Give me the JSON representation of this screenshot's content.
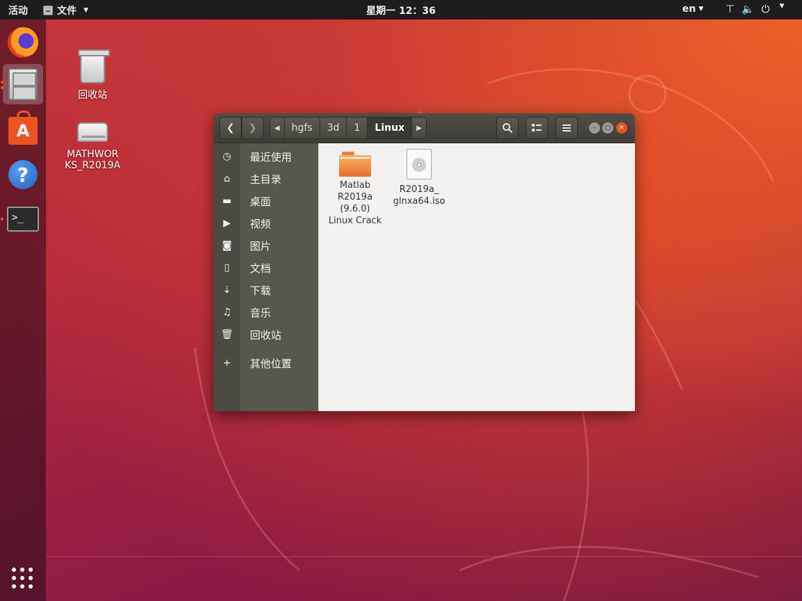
{
  "topbar": {
    "activities": "活动",
    "app_menu": "文件",
    "clock": "星期一 12：36",
    "lang": "en",
    "network_icon": "network-icon",
    "volume_icon": "volume-icon",
    "power_icon": "power-icon"
  },
  "dock": {
    "items": [
      "firefox",
      "files",
      "software-center",
      "help",
      "terminal"
    ],
    "show_apps_icon": "apps-grid-icon"
  },
  "desktop": {
    "icons": [
      {
        "label": "回收站",
        "icon": "trash-icon"
      },
      {
        "label": "MATHWORKS_R2019A",
        "icon": "drive-icon"
      }
    ]
  },
  "filemanager": {
    "path": [
      "hgfs",
      "3d",
      "1",
      "Linux"
    ],
    "sidebar": [
      {
        "label": "最近使用",
        "icon": "recent-icon"
      },
      {
        "label": "主目录",
        "icon": "home-icon"
      },
      {
        "label": "桌面",
        "icon": "desktop-folder-icon"
      },
      {
        "label": "视频",
        "icon": "video-icon"
      },
      {
        "label": "图片",
        "icon": "camera-icon"
      },
      {
        "label": "文档",
        "icon": "document-icon"
      },
      {
        "label": "下载",
        "icon": "download-icon"
      },
      {
        "label": "音乐",
        "icon": "music-icon"
      },
      {
        "label": "回收站",
        "icon": "trash-icon"
      },
      {
        "label": "其他位置",
        "icon": "plus-icon"
      }
    ],
    "files": [
      {
        "line1": "Matlab",
        "line2": "R2019a",
        "line3": "(9.6.0)",
        "line4": "Linux Crack",
        "type": "folder"
      },
      {
        "line1": "R2019a_",
        "line2": "glnxa64.iso",
        "type": "iso"
      }
    ]
  }
}
